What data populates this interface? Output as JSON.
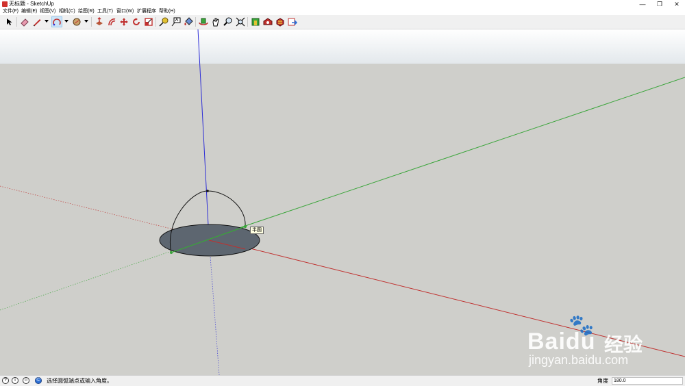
{
  "window": {
    "title": "无标题 - SketchUp",
    "app_icon": "sketchup-logo-icon",
    "controls": {
      "minimize": "—",
      "restore": "❐",
      "close": "✕"
    }
  },
  "menu": {
    "items": [
      "文件(F)",
      "编辑(E)",
      "视图(V)",
      "相机(C)",
      "绘图(R)",
      "工具(T)",
      "窗口(W)",
      "扩展程序",
      "帮助(H)"
    ]
  },
  "toolbar": {
    "tools": [
      {
        "name": "select-arrow-icon",
        "active": false
      },
      {
        "name": "eraser-icon",
        "active": false
      },
      {
        "name": "pencil-line-icon",
        "active": false,
        "dropdown": true
      },
      {
        "name": "arc-icon",
        "active": true,
        "dropdown": true
      },
      {
        "name": "shape-icon",
        "active": false,
        "dropdown": true
      },
      {
        "name": "push-pull-icon",
        "active": false
      },
      {
        "name": "offset-icon",
        "active": false
      },
      {
        "name": "move-icon",
        "active": false
      },
      {
        "name": "rotate-icon",
        "active": false
      },
      {
        "name": "scale-icon",
        "active": false
      },
      {
        "name": "tape-measure-icon",
        "active": false
      },
      {
        "name": "text-icon",
        "active": false
      },
      {
        "name": "paint-bucket-icon",
        "active": false
      },
      {
        "name": "orbit-icon",
        "active": false
      },
      {
        "name": "pan-icon",
        "active": false
      },
      {
        "name": "zoom-icon",
        "active": false
      },
      {
        "name": "zoom-extents-icon",
        "active": false
      },
      {
        "name": "3d-warehouse-icon",
        "active": false
      },
      {
        "name": "extension-warehouse-icon",
        "active": false
      },
      {
        "name": "layout-icon",
        "active": false
      },
      {
        "name": "send-to-layout-icon",
        "active": false
      }
    ]
  },
  "viewport": {
    "sky_color": "#e8ecef",
    "ground_color": "#cfcfcb",
    "axis_colors": {
      "red": "#c0302e",
      "green": "#3aa53a",
      "blue": "#2b2bd6"
    },
    "tooltip": "半圆"
  },
  "watermark": {
    "brand": "Bai",
    "brand_suffix": "du",
    "cn": "经验",
    "url": "jingyan.baidu.com"
  },
  "statusbar": {
    "icons": [
      "help-icon",
      "info-icon",
      "user-icon",
      "credits-icon"
    ],
    "message": "选择圆弧端点或输入角度。",
    "measure_label": "角度",
    "measure_value": "180.0"
  }
}
